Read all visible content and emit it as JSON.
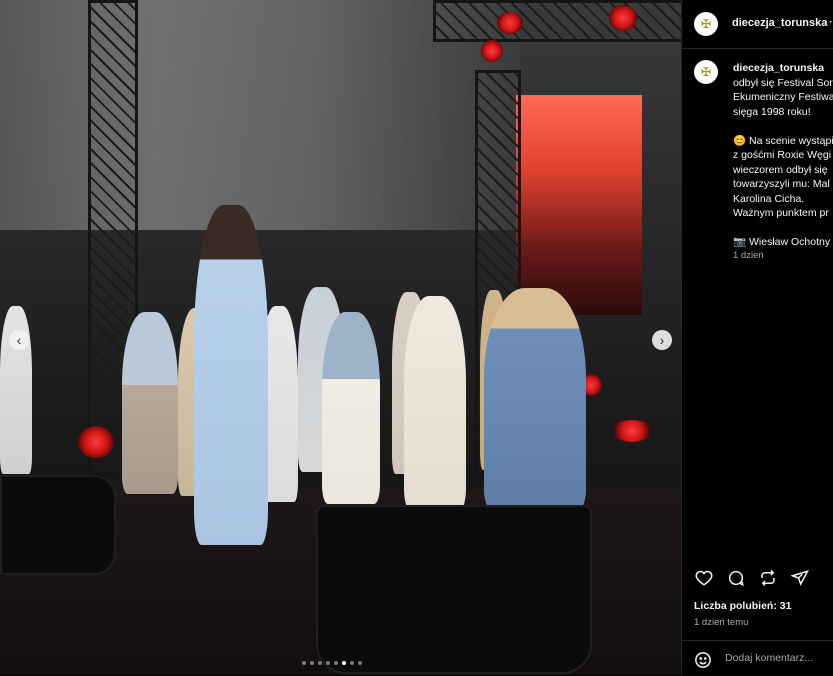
{
  "post": {
    "username": "diecezja_torunska",
    "caption_username": "diecezja_torunska",
    "caption_lines": [
      "odbył się Festival Sor",
      "Ekumeniczny Festiwa",
      "sięga 1998 roku!",
      "",
      "😊 Na scenie wystąpi",
      "z gośćmi Roxie Węgi",
      "wieczorem odbył się",
      "towarzyszyli mu: Mal",
      "Karolina Cicha.",
      "Ważnym punktem pr",
      "",
      "📷 Wiesław Ochotny"
    ],
    "caption_time": "1 dzień",
    "likes": "Liczba polubień: 31",
    "time": "1 dzień temu",
    "comment_placeholder": "Dodaj komentarz..."
  },
  "carousel": {
    "total": 8,
    "active": 5
  },
  "icons": {
    "more": "more-icon",
    "like": "heart-icon",
    "comment": "comment-icon",
    "share": "repost-icon",
    "send": "send-icon",
    "emoji": "emoji-icon"
  },
  "colors": {
    "background": "#000000",
    "text": "#f5f5f5",
    "muted": "#a8a8a8",
    "divider": "#262626"
  }
}
